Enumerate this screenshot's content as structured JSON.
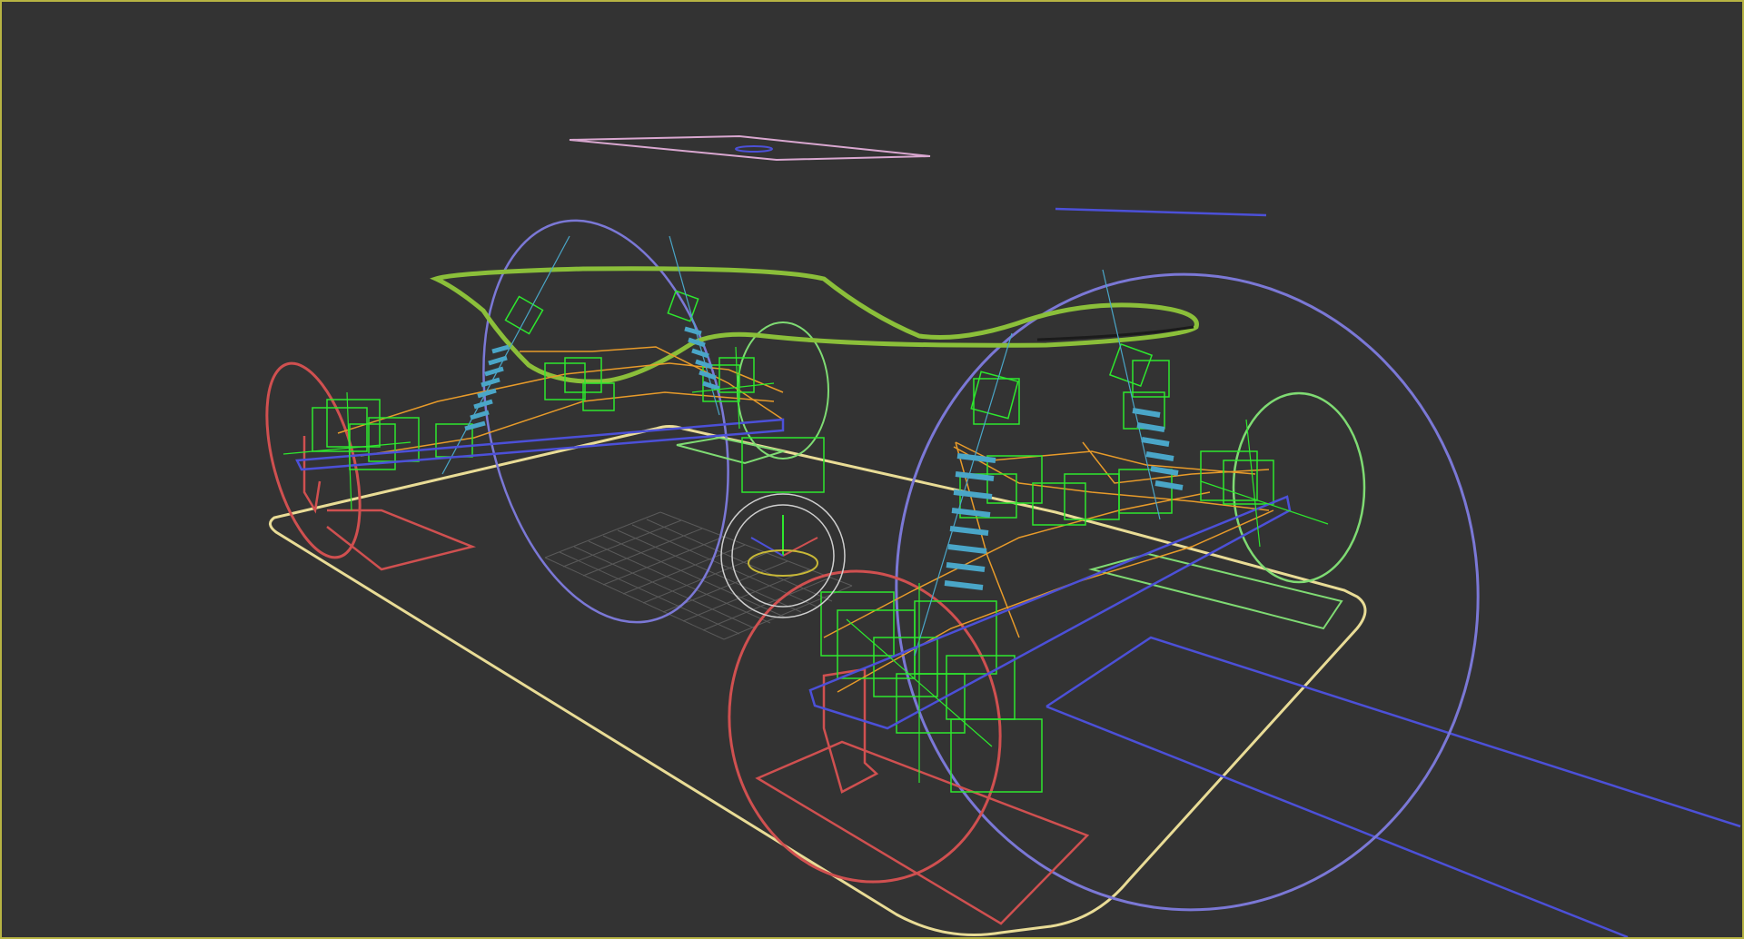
{
  "viewport": {
    "background_color": "#333333",
    "active_border_color": "#b7b443",
    "grid_color": "#5a5a5a"
  },
  "scene_colors": {
    "body_spline": "#8bbf3a",
    "wheel_circle_blue": "#7b78d6",
    "wheel_circle_red": "#d05050",
    "hub_circle_green": "#7fdb73",
    "helper_box_green": "#2ee82e",
    "bone_orange": "#e89b2a",
    "spring": "#4aa6c8",
    "base_outline": "#e9dc96",
    "control_blue": "#4c50d8",
    "top_helper_pink": "#d9a7d0",
    "transform_gizmo": "#cfcfcf"
  }
}
